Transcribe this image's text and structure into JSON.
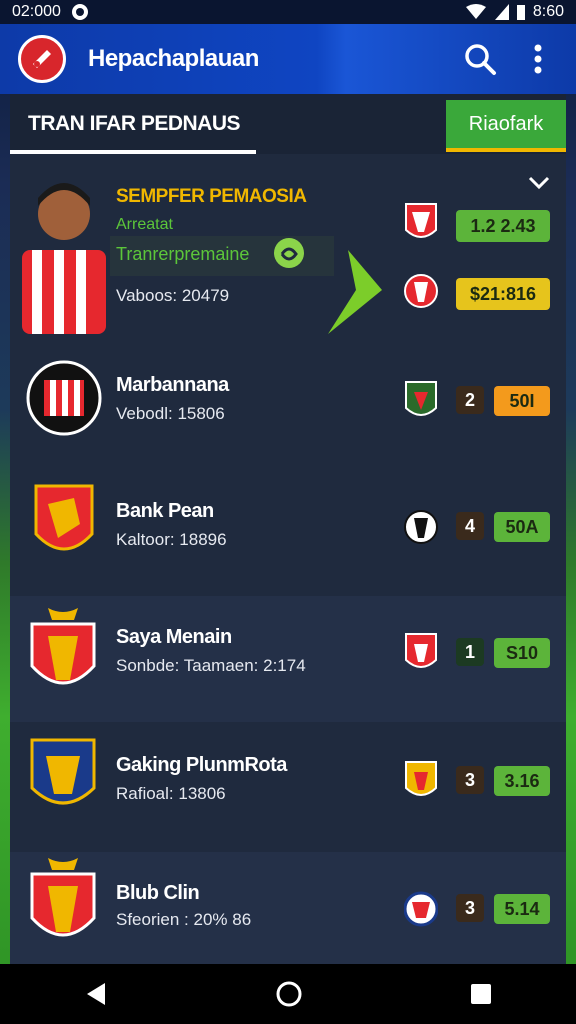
{
  "status": {
    "time": "02:000",
    "right_time": "8:60"
  },
  "app": {
    "title": "Hepachaplauan"
  },
  "panel": {
    "title": "TRAN IFAR PEDNAUS",
    "button": "Riaofark"
  },
  "featured": {
    "name": "SEMPFER PEMAOSIA",
    "role": "Arreatat",
    "tag": "Tranrerpremaine",
    "value": "Vaboos: 20479",
    "scores": [
      {
        "value": "1.2 2.43",
        "color": "#5cb43a"
      },
      {
        "value": "$21:816",
        "color": "#e6c41c"
      }
    ]
  },
  "rows": [
    {
      "name": "Marbannana",
      "sub": "Vebodl: 15806",
      "rank": "2",
      "score": "50I",
      "score_color": "#f39a1c",
      "alt": false
    },
    {
      "name": "Bank Pean",
      "sub": "Kaltoor: 18896",
      "rank": "4",
      "score": "50A",
      "score_color": "#5cb43a",
      "alt": false
    },
    {
      "name": "Saya Menain",
      "sub": "Sonbde: Taamaen: 2:174",
      "rank": "1",
      "score": "S10",
      "score_color": "#5cb43a",
      "alt": true
    },
    {
      "name": "Gaking PlunmRota",
      "sub": "Rafioal: 13806",
      "rank": "3",
      "score": "3.16",
      "score_color": "#5cb43a",
      "alt": false
    },
    {
      "name": "Blub Clin",
      "sub": "Sfeorien : 20% 86",
      "rank": "3",
      "score": "5.14",
      "score_color": "#5cb43a",
      "alt": true
    }
  ],
  "colors": {
    "accent": "#3aa83a",
    "appbar": "#0f45c2",
    "panel": "#1f2a3e"
  }
}
